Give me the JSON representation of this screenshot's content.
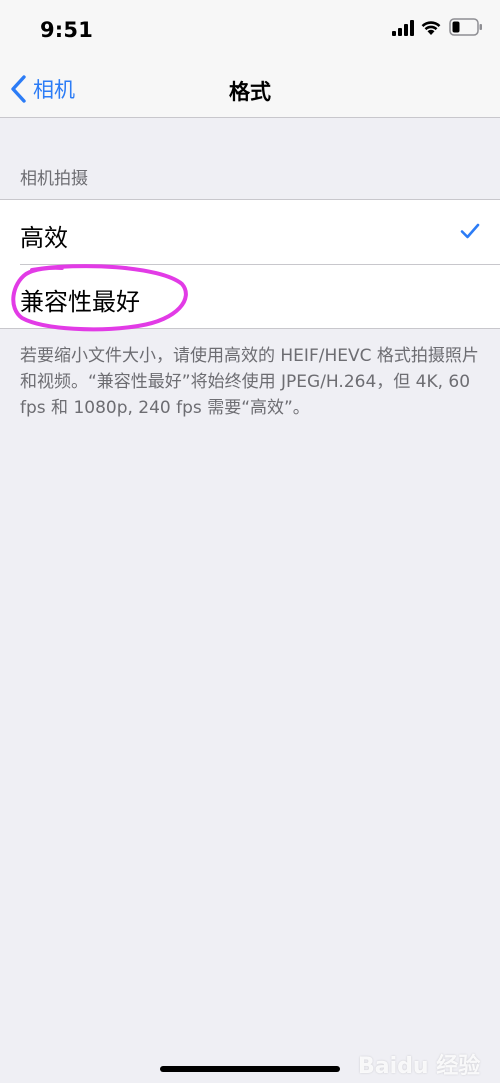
{
  "status_bar": {
    "time": "9:51"
  },
  "nav": {
    "back_label": "相机",
    "title": "格式"
  },
  "section": {
    "header": "相机拍摄",
    "options": [
      {
        "label": "高效",
        "selected": true
      },
      {
        "label": "兼容性最好",
        "selected": false
      }
    ],
    "footer": "若要缩小文件大小，请使用高效的 HEIF/HEVC 格式拍摄照片和视频。“兼容性最好”将始终使用 JPEG/H.264，但 4K, 60 fps 和 1080p, 240 fps 需要“高效”。"
  },
  "watermark": {
    "text": "Baidu 经验"
  },
  "colors": {
    "accent": "#2C7CF6",
    "highlight": "#E23BE6",
    "background": "#EFEFF4"
  }
}
